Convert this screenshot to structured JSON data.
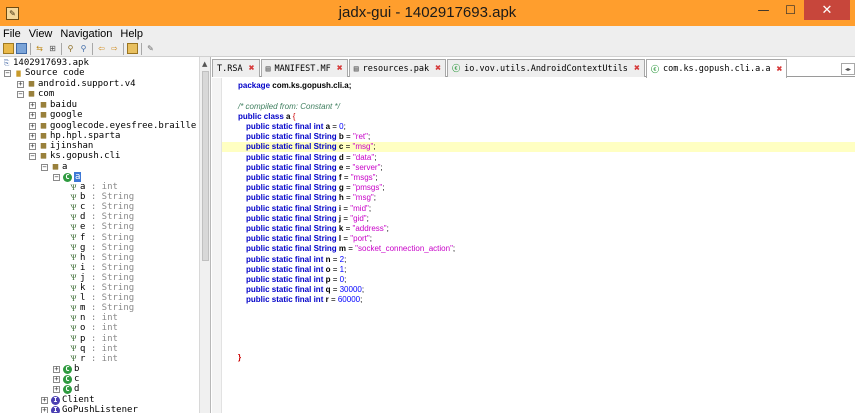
{
  "window": {
    "title": "jadx-gui - 1402917693.apk",
    "minimize": "—",
    "maximize": "☐",
    "close": "✕"
  },
  "menu": [
    "File",
    "View",
    "Navigation",
    "Help"
  ],
  "toolbar_icons": [
    "open-icon",
    "save-all-icon",
    "sync-icon",
    "flatten-icon",
    "search-icon",
    "find-class-icon",
    "back-icon",
    "forward-icon",
    "log-icon",
    "preferences-icon"
  ],
  "tree": {
    "root": "1402917693.apk",
    "source_code": "Source code",
    "packages": [
      "android.support.v4",
      "com",
      "baidu",
      "google",
      "googlecode.eyesfree.braille",
      "hp.hpl.sparta",
      "ijinshan",
      "ks.gopush.cli"
    ],
    "pkg_a": "a",
    "class_a": "a",
    "fields": [
      {
        "name": "a",
        "type": ": int"
      },
      {
        "name": "b",
        "type": ": String"
      },
      {
        "name": "c",
        "type": ": String"
      },
      {
        "name": "d",
        "type": ": String"
      },
      {
        "name": "e",
        "type": ": String"
      },
      {
        "name": "f",
        "type": ": String"
      },
      {
        "name": "g",
        "type": ": String"
      },
      {
        "name": "h",
        "type": ": String"
      },
      {
        "name": "i",
        "type": ": String"
      },
      {
        "name": "j",
        "type": ": String"
      },
      {
        "name": "k",
        "type": ": String"
      },
      {
        "name": "l",
        "type": ": String"
      },
      {
        "name": "m",
        "type": ": String"
      },
      {
        "name": "n",
        "type": ": int"
      },
      {
        "name": "o",
        "type": ": int"
      },
      {
        "name": "p",
        "type": ": int"
      },
      {
        "name": "q",
        "type": ": int"
      },
      {
        "name": "r",
        "type": ": int"
      }
    ],
    "classes_after": [
      "b",
      "c",
      "d"
    ],
    "interfaces": [
      "Client",
      "GoPushListener"
    ]
  },
  "tabs": [
    {
      "label": "T.RSA",
      "icon": ""
    },
    {
      "label": "MANIFEST.MF",
      "icon": "file"
    },
    {
      "label": "resources.pak",
      "icon": "file"
    },
    {
      "label": "io.vov.utils.AndroidContextUtils",
      "icon": "class"
    },
    {
      "label": "com.ks.gopush.cli.a.a",
      "icon": "class"
    }
  ],
  "code": {
    "package_kw": "package",
    "package_name": "com.ks.gopush.cli.a;",
    "comment": "/* compiled from: Constant */",
    "class_decl_kw": "public class",
    "class_name": "a",
    "open_brace": "{",
    "close_brace": "}",
    "modifiers": "public static final",
    "fields": [
      {
        "type": "int",
        "name": "a",
        "value": "0",
        "kind": "num"
      },
      {
        "type": "String",
        "name": "b",
        "value": "\"ret\"",
        "kind": "str"
      },
      {
        "type": "String",
        "name": "c",
        "value": "\"msg\"",
        "kind": "str"
      },
      {
        "type": "String",
        "name": "d",
        "value": "\"data\"",
        "kind": "str"
      },
      {
        "type": "String",
        "name": "e",
        "value": "\"server\"",
        "kind": "str"
      },
      {
        "type": "String",
        "name": "f",
        "value": "\"msgs\"",
        "kind": "str"
      },
      {
        "type": "String",
        "name": "g",
        "value": "\"pmsgs\"",
        "kind": "str"
      },
      {
        "type": "String",
        "name": "h",
        "value": "\"msg\"",
        "kind": "str"
      },
      {
        "type": "String",
        "name": "i",
        "value": "\"mid\"",
        "kind": "str"
      },
      {
        "type": "String",
        "name": "j",
        "value": "\"gid\"",
        "kind": "str"
      },
      {
        "type": "String",
        "name": "k",
        "value": "\"address\"",
        "kind": "str"
      },
      {
        "type": "String",
        "name": "l",
        "value": "\"port\"",
        "kind": "str"
      },
      {
        "type": "String",
        "name": "m",
        "value": "\"socket_connection_action\"",
        "kind": "str"
      },
      {
        "type": "int",
        "name": "n",
        "value": "2",
        "kind": "num"
      },
      {
        "type": "int",
        "name": "o",
        "value": "1",
        "kind": "num"
      },
      {
        "type": "int",
        "name": "p",
        "value": "0",
        "kind": "num"
      },
      {
        "type": "int",
        "name": "q",
        "value": "30000",
        "kind": "num"
      },
      {
        "type": "int",
        "name": "r",
        "value": "60000",
        "kind": "num"
      }
    ],
    "highlighted_field": "c"
  },
  "colors": {
    "titlebar": "#ff9e2d",
    "close_button": "#c7463b",
    "keyword": "#0000c8",
    "string": "#c800c8",
    "comment": "#3f7f5f",
    "selection": "#3d78d6",
    "line_highlight": "#ffffc2"
  }
}
